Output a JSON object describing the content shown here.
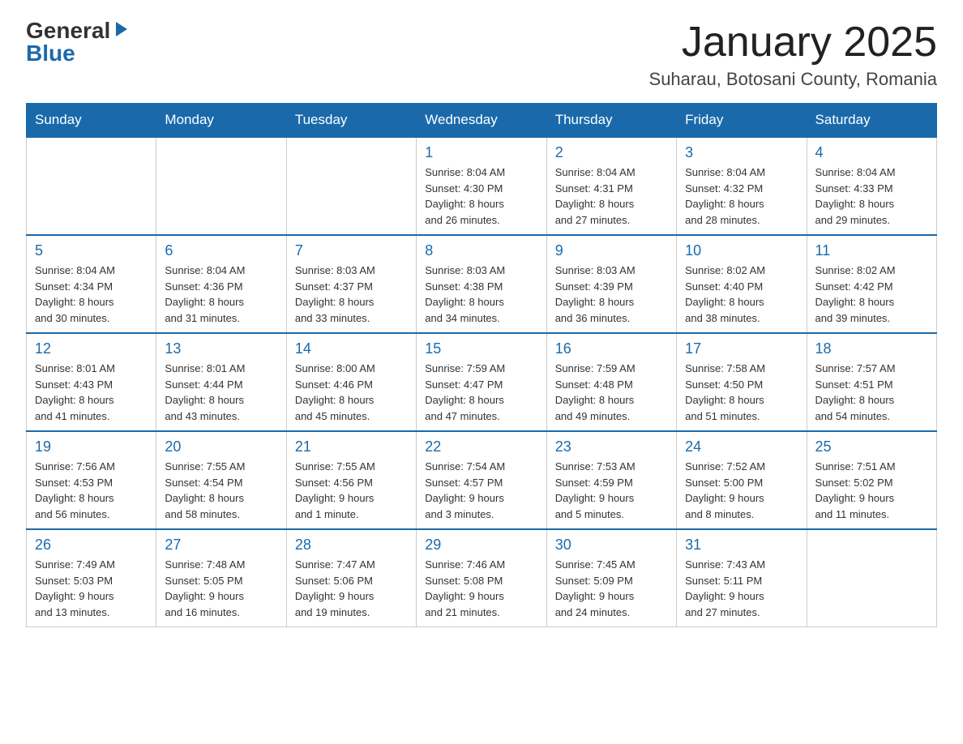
{
  "logo": {
    "general": "General",
    "blue": "Blue"
  },
  "title": "January 2025",
  "subtitle": "Suharau, Botosani County, Romania",
  "days_of_week": [
    "Sunday",
    "Monday",
    "Tuesday",
    "Wednesday",
    "Thursday",
    "Friday",
    "Saturday"
  ],
  "weeks": [
    [
      {
        "day": "",
        "info": ""
      },
      {
        "day": "",
        "info": ""
      },
      {
        "day": "",
        "info": ""
      },
      {
        "day": "1",
        "info": "Sunrise: 8:04 AM\nSunset: 4:30 PM\nDaylight: 8 hours\nand 26 minutes."
      },
      {
        "day": "2",
        "info": "Sunrise: 8:04 AM\nSunset: 4:31 PM\nDaylight: 8 hours\nand 27 minutes."
      },
      {
        "day": "3",
        "info": "Sunrise: 8:04 AM\nSunset: 4:32 PM\nDaylight: 8 hours\nand 28 minutes."
      },
      {
        "day": "4",
        "info": "Sunrise: 8:04 AM\nSunset: 4:33 PM\nDaylight: 8 hours\nand 29 minutes."
      }
    ],
    [
      {
        "day": "5",
        "info": "Sunrise: 8:04 AM\nSunset: 4:34 PM\nDaylight: 8 hours\nand 30 minutes."
      },
      {
        "day": "6",
        "info": "Sunrise: 8:04 AM\nSunset: 4:36 PM\nDaylight: 8 hours\nand 31 minutes."
      },
      {
        "day": "7",
        "info": "Sunrise: 8:03 AM\nSunset: 4:37 PM\nDaylight: 8 hours\nand 33 minutes."
      },
      {
        "day": "8",
        "info": "Sunrise: 8:03 AM\nSunset: 4:38 PM\nDaylight: 8 hours\nand 34 minutes."
      },
      {
        "day": "9",
        "info": "Sunrise: 8:03 AM\nSunset: 4:39 PM\nDaylight: 8 hours\nand 36 minutes."
      },
      {
        "day": "10",
        "info": "Sunrise: 8:02 AM\nSunset: 4:40 PM\nDaylight: 8 hours\nand 38 minutes."
      },
      {
        "day": "11",
        "info": "Sunrise: 8:02 AM\nSunset: 4:42 PM\nDaylight: 8 hours\nand 39 minutes."
      }
    ],
    [
      {
        "day": "12",
        "info": "Sunrise: 8:01 AM\nSunset: 4:43 PM\nDaylight: 8 hours\nand 41 minutes."
      },
      {
        "day": "13",
        "info": "Sunrise: 8:01 AM\nSunset: 4:44 PM\nDaylight: 8 hours\nand 43 minutes."
      },
      {
        "day": "14",
        "info": "Sunrise: 8:00 AM\nSunset: 4:46 PM\nDaylight: 8 hours\nand 45 minutes."
      },
      {
        "day": "15",
        "info": "Sunrise: 7:59 AM\nSunset: 4:47 PM\nDaylight: 8 hours\nand 47 minutes."
      },
      {
        "day": "16",
        "info": "Sunrise: 7:59 AM\nSunset: 4:48 PM\nDaylight: 8 hours\nand 49 minutes."
      },
      {
        "day": "17",
        "info": "Sunrise: 7:58 AM\nSunset: 4:50 PM\nDaylight: 8 hours\nand 51 minutes."
      },
      {
        "day": "18",
        "info": "Sunrise: 7:57 AM\nSunset: 4:51 PM\nDaylight: 8 hours\nand 54 minutes."
      }
    ],
    [
      {
        "day": "19",
        "info": "Sunrise: 7:56 AM\nSunset: 4:53 PM\nDaylight: 8 hours\nand 56 minutes."
      },
      {
        "day": "20",
        "info": "Sunrise: 7:55 AM\nSunset: 4:54 PM\nDaylight: 8 hours\nand 58 minutes."
      },
      {
        "day": "21",
        "info": "Sunrise: 7:55 AM\nSunset: 4:56 PM\nDaylight: 9 hours\nand 1 minute."
      },
      {
        "day": "22",
        "info": "Sunrise: 7:54 AM\nSunset: 4:57 PM\nDaylight: 9 hours\nand 3 minutes."
      },
      {
        "day": "23",
        "info": "Sunrise: 7:53 AM\nSunset: 4:59 PM\nDaylight: 9 hours\nand 5 minutes."
      },
      {
        "day": "24",
        "info": "Sunrise: 7:52 AM\nSunset: 5:00 PM\nDaylight: 9 hours\nand 8 minutes."
      },
      {
        "day": "25",
        "info": "Sunrise: 7:51 AM\nSunset: 5:02 PM\nDaylight: 9 hours\nand 11 minutes."
      }
    ],
    [
      {
        "day": "26",
        "info": "Sunrise: 7:49 AM\nSunset: 5:03 PM\nDaylight: 9 hours\nand 13 minutes."
      },
      {
        "day": "27",
        "info": "Sunrise: 7:48 AM\nSunset: 5:05 PM\nDaylight: 9 hours\nand 16 minutes."
      },
      {
        "day": "28",
        "info": "Sunrise: 7:47 AM\nSunset: 5:06 PM\nDaylight: 9 hours\nand 19 minutes."
      },
      {
        "day": "29",
        "info": "Sunrise: 7:46 AM\nSunset: 5:08 PM\nDaylight: 9 hours\nand 21 minutes."
      },
      {
        "day": "30",
        "info": "Sunrise: 7:45 AM\nSunset: 5:09 PM\nDaylight: 9 hours\nand 24 minutes."
      },
      {
        "day": "31",
        "info": "Sunrise: 7:43 AM\nSunset: 5:11 PM\nDaylight: 9 hours\nand 27 minutes."
      },
      {
        "day": "",
        "info": ""
      }
    ]
  ]
}
